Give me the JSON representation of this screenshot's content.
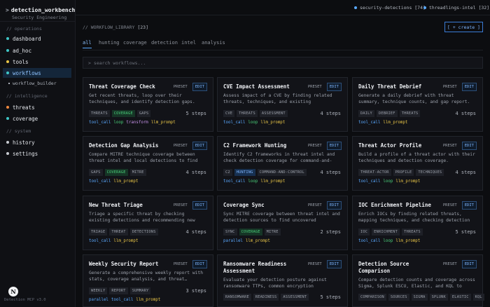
{
  "app": {
    "title": "detection_workbench",
    "title_prefix": ">",
    "subtitle": "Security Engineering",
    "version": "Detection MCP v3.0",
    "logo_letter": "N"
  },
  "nav": {
    "sections": [
      {
        "label": "// operations"
      },
      {
        "label": "// intelligence"
      },
      {
        "label": "// system"
      }
    ],
    "items": [
      {
        "label": "dashboard",
        "color": "#3fc8c8"
      },
      {
        "label": "ad_hoc",
        "color": "#3fc8c8"
      },
      {
        "label": "tools",
        "color": "#e8c547"
      },
      {
        "label": "workflows",
        "color": "#3fc8c8",
        "active": true
      },
      {
        "label": "threats",
        "color": "#f0883e"
      },
      {
        "label": "coverage",
        "color": "#3fc8c8"
      },
      {
        "label": "history",
        "color": "#c9ccd2"
      },
      {
        "label": "settings",
        "color": "#c9ccd2"
      }
    ],
    "sub_item": {
      "label": "workflow_builder"
    }
  },
  "topbar": {
    "repos": [
      {
        "label": "security-detections [74]"
      },
      {
        "label": "threadlings-intel [32]"
      }
    ]
  },
  "main": {
    "header": "// WORKFLOW_LIBRARY",
    "count": "[23]",
    "create_label": "[ + create ]",
    "tabs": [
      "all",
      "hunting",
      "coverage",
      "detection",
      "intel",
      "analysis"
    ],
    "search_placeholder": "search workflows..."
  },
  "colors": {
    "tool_call": "#5aa9ff",
    "loop": "#4ad07a",
    "transform": "#c792ea",
    "llm_prompt": "#e8c547",
    "parallel": "#5aa9ff"
  },
  "cards": [
    {
      "title": "Threat Coverage Check",
      "desc": "Get recent threats, loop over their techniques, and identify detection gaps.",
      "tags": [
        "THREATS",
        "COVERAGE",
        "GAPS"
      ],
      "steps": "5 steps",
      "tools": [
        "tool_call",
        "loop",
        "transform",
        "llm_prompt"
      ]
    },
    {
      "title": "CVE Impact Assessment",
      "desc": "Assess impact of a CVE by finding related threats, techniques, and existing detections.",
      "tags": [
        "CVE",
        "THREATS",
        "ASSESSMENT"
      ],
      "steps": "4 steps",
      "tools": [
        "tool_call",
        "loop",
        "llm_prompt"
      ]
    },
    {
      "title": "Daily Threat Debrief",
      "desc": "Generate a daily debrief with threat summary, technique counts, and gap report.",
      "tags": [
        "DAILY",
        "DEBRIEF",
        "THREATS"
      ],
      "steps": "4 steps",
      "tools": [
        "tool_call",
        "llm_prompt"
      ]
    },
    {
      "title": "Detection Gap Analysis",
      "desc": "Compare MITRE technique coverage between threat intel and local detections to find gaps.",
      "tags": [
        "GAPS",
        "COVERAGE",
        "MITRE"
      ],
      "steps": "4 steps",
      "tools": [
        "tool_call",
        "llm_prompt"
      ]
    },
    {
      "title": "C2 Framework Hunting",
      "desc": "Identify C2 frameworks in threat intel and check detection coverage for command-and-control…",
      "tags": [
        "C2",
        "HUNTING",
        "COMMAND-AND-CONTROL"
      ],
      "steps": "4 steps",
      "tools": [
        "tool_call",
        "loop",
        "llm_prompt"
      ]
    },
    {
      "title": "Threat Actor Profile",
      "desc": "Build a profile of a threat actor with their techniques and detection coverage.",
      "tags": [
        "THREAT-ACTOR",
        "PROFILE",
        "TECHNIQUES"
      ],
      "steps": "4 steps",
      "tools": [
        "tool_call",
        "loop",
        "llm_prompt"
      ]
    },
    {
      "title": "New Threat Triage",
      "desc": "Triage a specific threat by checking existing detections and recommending new ones.",
      "tags": [
        "TRIAGE",
        "THREAT",
        "DETECTIONS"
      ],
      "steps": "4 steps",
      "tools": [
        "tool_call",
        "llm_prompt"
      ]
    },
    {
      "title": "Coverage Sync",
      "desc": "Sync MITRE coverage between threat intel and detection sources to find uncovered techniques.",
      "tags": [
        "SYNC",
        "COVERAGE",
        "MITRE"
      ],
      "steps": "2 steps",
      "tools": [
        "parallel",
        "llm_prompt"
      ]
    },
    {
      "title": "IOC Enrichment Pipeline",
      "desc": "Enrich IOCs by finding related threats, mapping techniques, and checking detection coverage.",
      "tags": [
        "IOC",
        "ENRICHMENT",
        "THREATS"
      ],
      "steps": "5 steps",
      "tools": [
        "tool_call",
        "loop",
        "llm_prompt"
      ]
    },
    {
      "title": "Weekly Security Report",
      "desc": "Generate a comprehensive weekly report with stats, coverage analysis, and threat…",
      "tags": [
        "WEEKLY",
        "REPORT",
        "SUMMARY"
      ],
      "steps": "3 steps",
      "tools": [
        "parallel",
        "tool_call",
        "llm_prompt"
      ]
    },
    {
      "title": "Ransomware Readiness Assessment",
      "desc": "Evaluate your detection posture against ransomware TTPs, common encryption behaviors,…",
      "tags": [
        "RANSOMWARE",
        "READINESS",
        "ASSESSMENT"
      ],
      "steps": "5 steps",
      "tools": []
    },
    {
      "title": "Detection Source Comparison",
      "desc": "Compare detection counts and coverage across Sigma, Splunk ESCU, Elastic, and KQL to find…",
      "tags": [
        "COMPARISON",
        "SOURCES",
        "SIGMA",
        "SPLUNK",
        "ELASTIC",
        "KQL"
      ],
      "steps": "",
      "tools": []
    }
  ],
  "card_buttons": {
    "preset": "PRESET",
    "edit": "EDIT"
  }
}
